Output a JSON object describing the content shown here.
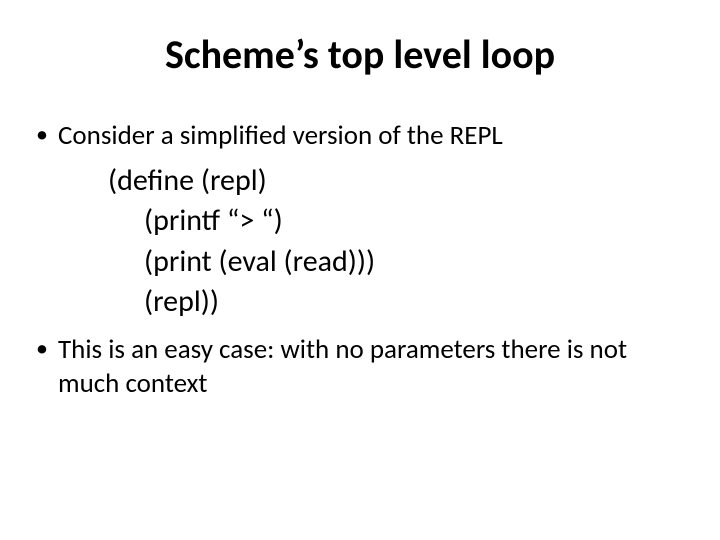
{
  "title": "Scheme’s top level loop",
  "bullet1": "Consider a simplified version of the REPL",
  "code": {
    "l1": "(define (repl)",
    "l2": "(printf “> “)",
    "l3": "(print (eval (read)))",
    "l4": "(repl))"
  },
  "bullet2": "This is an easy case: with no parameters there is not much context"
}
